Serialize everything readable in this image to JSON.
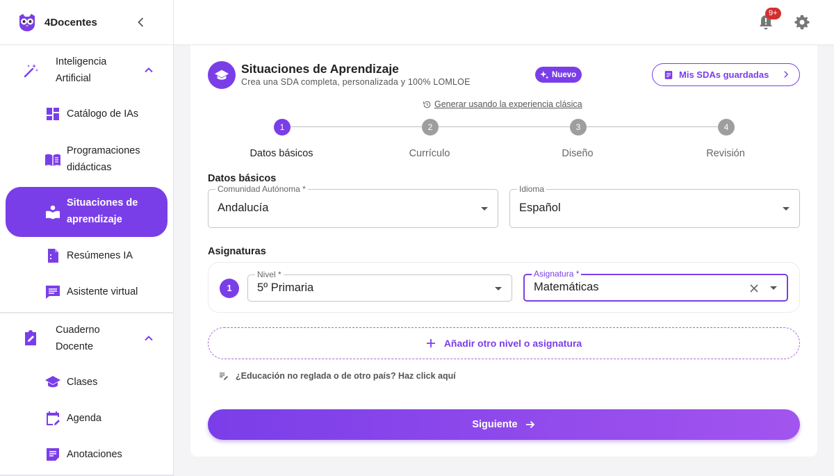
{
  "brand": {
    "name": "4Docentes"
  },
  "sidebar": {
    "sections": [
      {
        "label": "Inteligencia Artificial",
        "label_line1": "Inteligencia",
        "label_line2": "Artificial"
      },
      {
        "label": "Cuaderno Docente",
        "label_line1": "Cuaderno",
        "label_line2": "Docente"
      }
    ],
    "items": [
      {
        "label": "Catálogo de IAs"
      },
      {
        "label_line1": "Programaciones",
        "label_line2": "didácticas"
      },
      {
        "label_line1": "Situaciones de",
        "label_line2": "aprendizaje",
        "active": true
      },
      {
        "label": "Resúmenes IA"
      },
      {
        "label": "Asistente virtual"
      },
      {
        "label": "Clases"
      },
      {
        "label": "Agenda"
      },
      {
        "label": "Anotaciones"
      }
    ]
  },
  "topbar": {
    "notifications_badge": "9+"
  },
  "header": {
    "title": "Situaciones de Aprendizaje",
    "subtitle": "Crea una SDA completa, personalizada y 100% LOMLOE",
    "badge": "Nuevo",
    "saved_button": "Mis SDAs guardadas",
    "classic_link": "Generar usando la experiencia clásica"
  },
  "stepper": {
    "steps": [
      {
        "number": "1",
        "label": "Datos básicos",
        "active": true
      },
      {
        "number": "2",
        "label": "Currículo",
        "active": false
      },
      {
        "number": "3",
        "label": "Diseño",
        "active": false
      },
      {
        "number": "4",
        "label": "Revisión",
        "active": false
      }
    ]
  },
  "basics": {
    "title": "Datos básicos",
    "comunidad": {
      "label": "Comunidad Autónoma *",
      "value": "Andalucía"
    },
    "idioma": {
      "label": "Idioma",
      "value": "Español"
    }
  },
  "subjects": {
    "title": "Asignaturas",
    "rows": [
      {
        "number": "1",
        "nivel": {
          "label": "Nivel *",
          "value": "5º Primaria"
        },
        "asignatura": {
          "label": "Asignatura *",
          "value": "Matemáticas"
        }
      }
    ],
    "add_button": "Añadir otro nivel o asignatura",
    "nonreg_link": "¿Educación no reglada o de otro país? Haz click aquí"
  },
  "actions": {
    "next": "Siguiente"
  },
  "colors": {
    "accent": "#7a3ee8",
    "badge": "#d32f2f"
  }
}
